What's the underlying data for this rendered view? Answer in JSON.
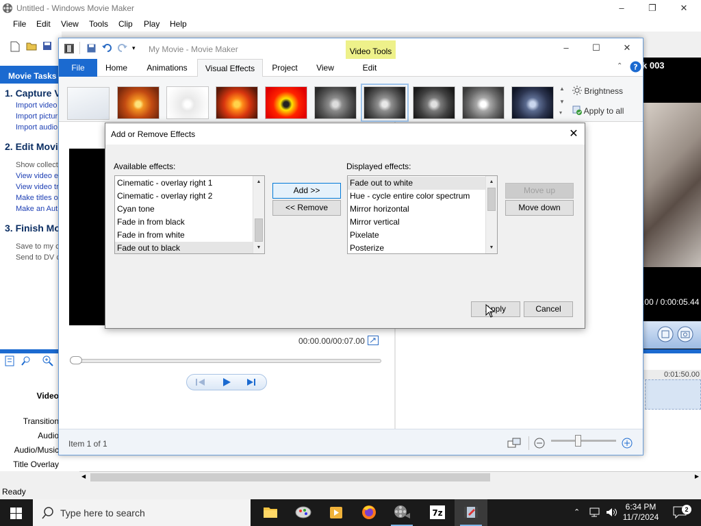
{
  "old_window": {
    "title": "Untitled - Windows Movie Maker",
    "menu": [
      "File",
      "Edit",
      "View",
      "Tools",
      "Clip",
      "Play",
      "Help"
    ],
    "tasks_header": "Movie Tasks",
    "sections": [
      {
        "title": "1. Capture V",
        "links": [
          "Import video",
          "Import pictur",
          "Import audio"
        ]
      },
      {
        "title": "2. Edit Movi",
        "links": [
          "Show collecti",
          "View video e",
          "View video tr",
          "Make titles o",
          "Make an Aut"
        ]
      },
      {
        "title": "3. Finish Mo",
        "links": [
          "Save to my c",
          "Send to DV c"
        ]
      }
    ],
    "right_title": "k 003",
    "right_time": ".00 / 0:00:05.44",
    "ruler_time": "0:01:50.00",
    "track_labels": [
      "Video",
      "Transition",
      "Audio",
      "Audio/Music",
      "Title Overlay"
    ],
    "status": "Ready"
  },
  "mm_window": {
    "title": "My Movie - Movie Maker",
    "contextual_tab": "Video Tools",
    "tabs": [
      "File",
      "Home",
      "Animations",
      "Visual Effects",
      "Project",
      "View",
      "Edit"
    ],
    "active_tab": "Visual Effects",
    "brightness_label": "Brightness",
    "apply_all_label": "Apply to all",
    "timecode": "00:00.00/00:07.00",
    "status_item": "Item 1 of 1"
  },
  "dialog": {
    "title": "Add or Remove Effects",
    "available_label": "Available effects:",
    "displayed_label": "Displayed effects:",
    "available_effects": [
      "Cinematic - overlay right 1",
      "Cinematic - overlay right 2",
      "Cyan tone",
      "Fade in from black",
      "Fade in from white",
      "Fade out to black"
    ],
    "available_selected": "Fade out to black",
    "displayed_effects": [
      "Fade out to white",
      "Hue - cycle entire color spectrum",
      "Mirror horizontal",
      "Mirror vertical",
      "Pixelate",
      "Posterize"
    ],
    "displayed_selected": "Fade out to white",
    "add_label": "Add >>",
    "remove_label": "<< Remove",
    "move_up_label": "Move up",
    "move_down_label": "Move down",
    "apply_label": "Apply",
    "cancel_label": "Cancel"
  },
  "taskbar": {
    "search_placeholder": "Type here to search",
    "time": "6:34 PM",
    "date": "11/7/2024"
  },
  "colors": {
    "accent": "#1b6ad0",
    "contextual_tab_bg": "#eef18a",
    "taskbar_bg": "#1a1a1a"
  }
}
